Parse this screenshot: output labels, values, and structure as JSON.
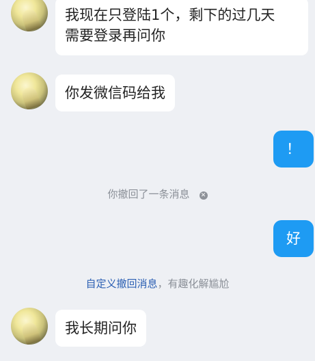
{
  "messages": {
    "m1": {
      "line1": "我现在只登陆1个，剩下的过几天",
      "line2": "需要登录再问你"
    },
    "m2": {
      "text": "你发微信码给我"
    },
    "m3": {
      "text": "！"
    },
    "m4": {
      "text": "好"
    },
    "m5": {
      "text": "我长期问你"
    }
  },
  "notices": {
    "recalled": "你撤回了一条消息",
    "recall_close_icon": "close-circle-icon",
    "custom_link": "自定义撤回消息",
    "custom_suffix": "，有趣化解尴尬"
  },
  "colors": {
    "background": "#eef0f4",
    "incoming_bubble": "#ffffff",
    "outgoing_bubble": "#1e9bf3",
    "link": "#2b5fb3",
    "notice_text": "#8a8f97"
  }
}
